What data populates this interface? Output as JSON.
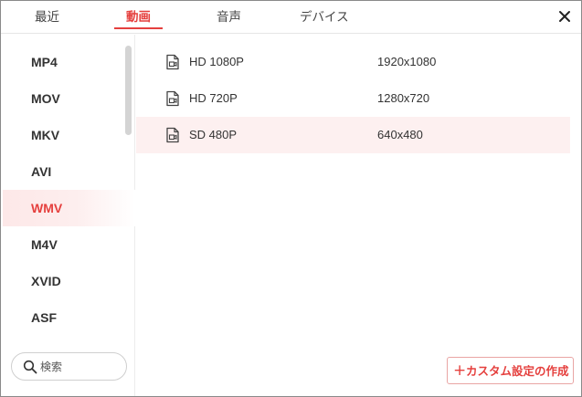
{
  "tabs": [
    {
      "label": "最近"
    },
    {
      "label": "動画"
    },
    {
      "label": "音声"
    },
    {
      "label": "デバイス"
    }
  ],
  "active_tab": "動画",
  "formats": [
    {
      "label": "MP4"
    },
    {
      "label": "MOV"
    },
    {
      "label": "MKV"
    },
    {
      "label": "AVI"
    },
    {
      "label": "WMV"
    },
    {
      "label": "M4V"
    },
    {
      "label": "XVID"
    },
    {
      "label": "ASF"
    }
  ],
  "selected_format": "WMV",
  "search": {
    "placeholder": "検索"
  },
  "resolutions": [
    {
      "name": "HD 1080P",
      "dimensions": "1920x1080"
    },
    {
      "name": "HD 720P",
      "dimensions": "1280x720"
    },
    {
      "name": "SD 480P",
      "dimensions": "640x480"
    }
  ],
  "selected_resolution": "SD 480P",
  "custom_button": {
    "plus": "+",
    "label": "カスタム設定の作成"
  },
  "colors": {
    "accent": "#e5403e",
    "selected_bg": "#fdf0f0",
    "text": "#333333"
  },
  "icons": {
    "close": "close-icon",
    "search": "search-icon",
    "file": "video-file-icon"
  }
}
